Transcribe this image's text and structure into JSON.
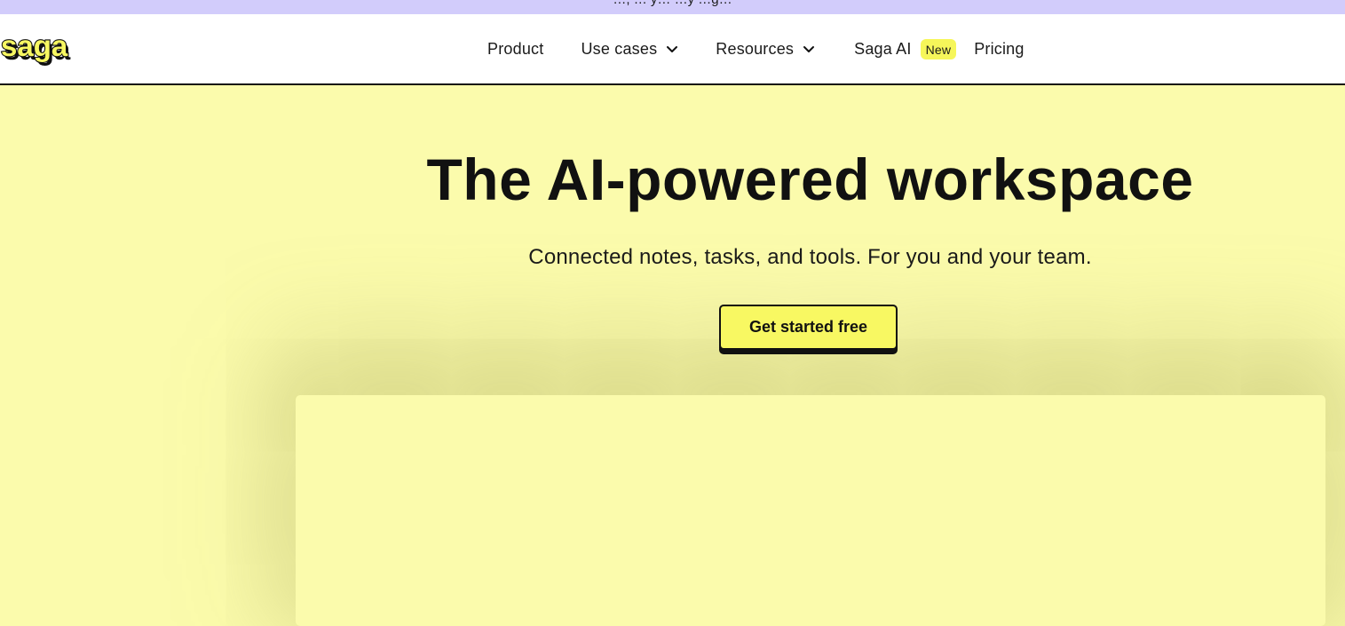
{
  "announcement": {
    "text": "…, … y… …y …g…"
  },
  "brand": {
    "logo_text": "saga"
  },
  "nav": {
    "product": "Product",
    "use_cases": "Use cases",
    "resources": "Resources",
    "saga_ai": "Saga AI",
    "new_badge": "New",
    "pricing": "Pricing",
    "dropdown_icon": "chevron-down-icon"
  },
  "hero": {
    "title": "The AI-powered workspace",
    "subtitle": "Connected notes, tasks, and tools. For you and your team.",
    "cta_label": "Get started free"
  },
  "colors": {
    "announce_bar": "#d2ccfb",
    "hero_background": "#fbfbac",
    "accent_yellow": "#f8f862",
    "text": "#111111"
  }
}
